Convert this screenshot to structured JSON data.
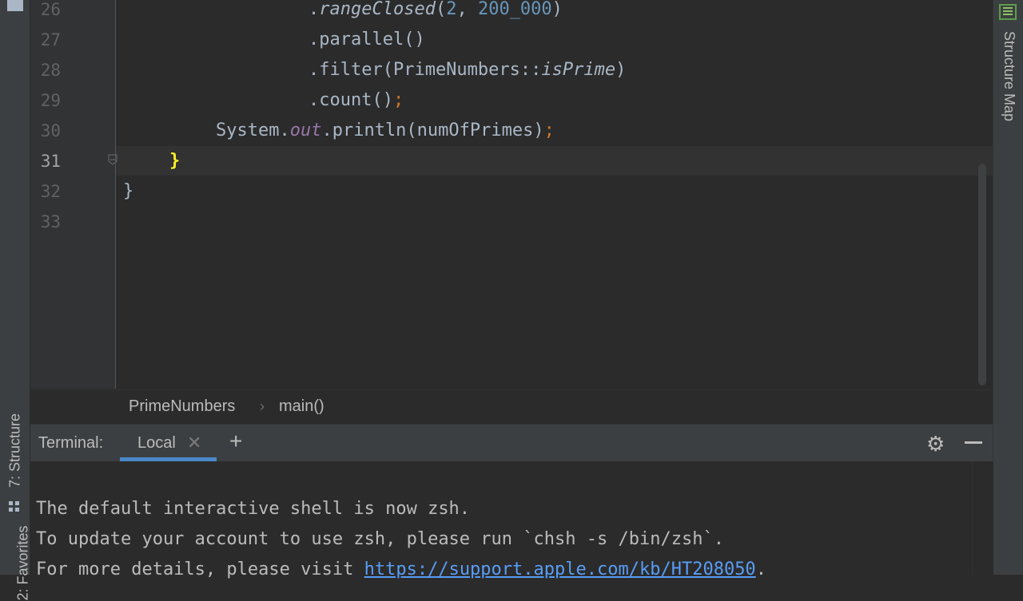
{
  "editor": {
    "gutter": [
      "26",
      "27",
      "28",
      "29",
      "30",
      "31",
      "32",
      "33"
    ],
    "lines": {
      "l26": {
        "dot": ".",
        "method": "rangeClosed",
        "open": "(",
        "n1": "2",
        "comma": ", ",
        "n2": "200_000",
        "close": ")"
      },
      "l27": {
        "text": ".parallel()"
      },
      "l28": {
        "pre": ".filter(PrimeNumbers::",
        "method": "isPrime",
        "post": ")"
      },
      "l29": {
        "text": ".count()",
        "semi": ";"
      },
      "l30": {
        "pre": "System.",
        "field": "out",
        "post": ".println(numOfPrimes)",
        "semi": ";"
      },
      "l31": {
        "brace": "}"
      },
      "l32": {
        "brace": "}"
      }
    }
  },
  "breadcrumb": {
    "items": [
      "PrimeNumbers",
      "main()"
    ],
    "separator": "›"
  },
  "terminal": {
    "title": "Terminal:",
    "tab_label": "Local",
    "close_glyph": "✕",
    "add_glyph": "+",
    "settings_glyph": "⚙",
    "lines": {
      "l1": "The default interactive shell is now zsh.",
      "l2": "To update your account to use zsh, please run `chsh -s /bin/zsh`.",
      "l3_pre": "For more details, please visit ",
      "l3_link": "https://support.apple.com/kb/HT208050",
      "l3_post": "."
    }
  },
  "left_strip": {
    "structure_label": "7: Structure",
    "favorites_label": "2: Favorites"
  },
  "right_strip": {
    "structure_map_label": "Structure Map"
  },
  "colors": {
    "background": "#2b2b2b",
    "panel": "#3c3f41",
    "accent": "#4a88c7",
    "number": "#6897bb",
    "static_field": "#9876aa",
    "keyword": "#cc7832",
    "brace_highlight": "#ffef28",
    "link": "#589df6"
  },
  "icons": [
    "fold-marker-icon",
    "close-icon",
    "plus-icon",
    "gear-icon",
    "minimize-icon",
    "structure-map-icon",
    "structure-icon"
  ]
}
